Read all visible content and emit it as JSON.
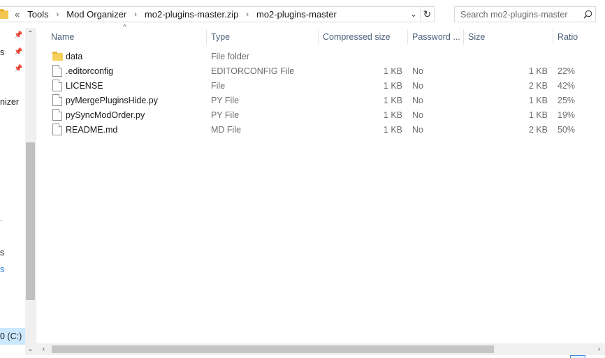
{
  "address_bar": {
    "overflow_label": "«",
    "crumbs": [
      "Tools",
      "Mod Organizer",
      "mo2-plugins-master.zip",
      "mo2-plugins-master"
    ],
    "dropdown_icon": "chevron-down-icon",
    "refresh_icon": "refresh-icon"
  },
  "search": {
    "placeholder": "Search mo2-plugins-master",
    "icon": "search-icon"
  },
  "nav_pane": {
    "fragments": [
      "s",
      "nizer",
      "s",
      "s",
      "s",
      "0 (C:)"
    ],
    "pinned_count": 3,
    "selected": "0 (C:)"
  },
  "columns": {
    "name": "Name",
    "type": "Type",
    "compressed_size": "Compressed size",
    "password": "Password ...",
    "size": "Size",
    "ratio": "Ratio"
  },
  "sort_indicator": "^",
  "files": [
    {
      "name": "data",
      "type": "File folder",
      "compressed": "",
      "password": "",
      "size": "",
      "ratio": "",
      "icon": "folder-icon"
    },
    {
      "name": ".editorconfig",
      "type": "EDITORCONFIG File",
      "compressed": "1 KB",
      "password": "No",
      "size": "1 KB",
      "ratio": "22%",
      "icon": "file-icon"
    },
    {
      "name": "LICENSE",
      "type": "File",
      "compressed": "1 KB",
      "password": "No",
      "size": "2 KB",
      "ratio": "42%",
      "icon": "file-icon"
    },
    {
      "name": "pyMergePluginsHide.py",
      "type": "PY File",
      "compressed": "1 KB",
      "password": "No",
      "size": "1 KB",
      "ratio": "25%",
      "icon": "file-icon"
    },
    {
      "name": "pySyncModOrder.py",
      "type": "PY File",
      "compressed": "1 KB",
      "password": "No",
      "size": "1 KB",
      "ratio": "19%",
      "icon": "file-icon"
    },
    {
      "name": "README.md",
      "type": "MD File",
      "compressed": "1 KB",
      "password": "No",
      "size": "2 KB",
      "ratio": "50%",
      "icon": "file-icon"
    }
  ],
  "colors": {
    "selection": "#cce8ff",
    "header_text": "#4c607a",
    "folder": "#f6cf5c",
    "link_blue": "#1e74d6"
  }
}
